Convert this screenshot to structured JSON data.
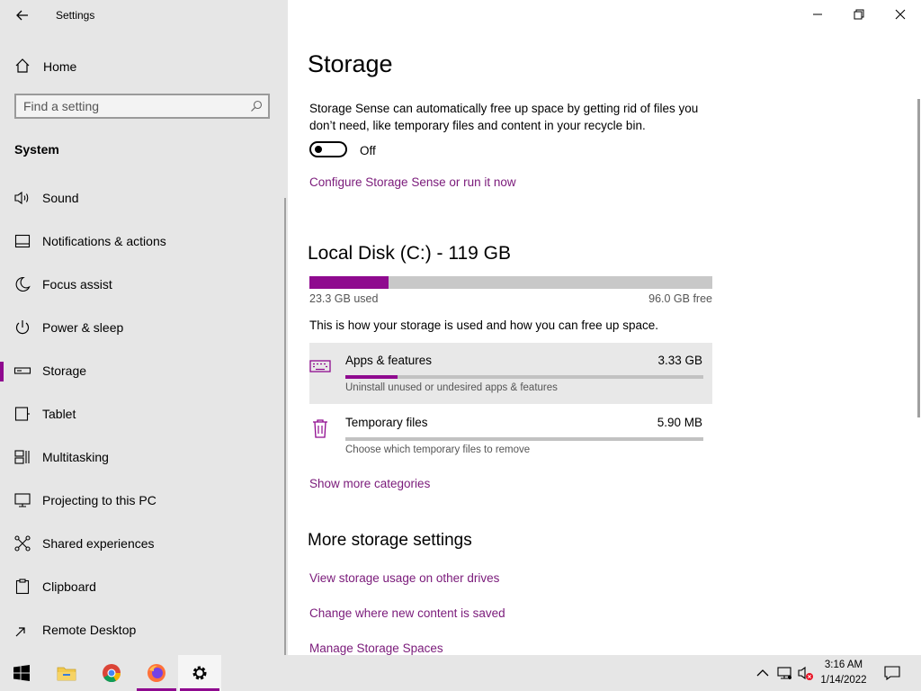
{
  "window": {
    "title": "Settings"
  },
  "sidebar": {
    "home_label": "Home",
    "search_placeholder": "Find a setting",
    "section": "System",
    "items": [
      {
        "label": "Sound",
        "icon": "speaker-icon",
        "active": false
      },
      {
        "label": "Notifications & actions",
        "icon": "notification-icon",
        "active": false
      },
      {
        "label": "Focus assist",
        "icon": "moon-icon",
        "active": false
      },
      {
        "label": "Power & sleep",
        "icon": "power-icon",
        "active": false
      },
      {
        "label": "Storage",
        "icon": "storage-icon",
        "active": true
      },
      {
        "label": "Tablet",
        "icon": "tablet-icon",
        "active": false
      },
      {
        "label": "Multitasking",
        "icon": "multitasking-icon",
        "active": false
      },
      {
        "label": "Projecting to this PC",
        "icon": "projecting-icon",
        "active": false
      },
      {
        "label": "Shared experiences",
        "icon": "shared-experiences-icon",
        "active": false
      },
      {
        "label": "Clipboard",
        "icon": "clipboard-icon",
        "active": false
      },
      {
        "label": "Remote Desktop",
        "icon": "remote-desktop-icon",
        "active": false
      }
    ]
  },
  "main": {
    "title": "Storage",
    "storage_sense_desc": "Storage Sense can automatically free up space by getting rid of files you don’t need, like temporary files and content in your recycle bin.",
    "toggle_state": "Off",
    "configure_link": "Configure Storage Sense or run it now",
    "disk": {
      "title": "Local Disk (C:) - 119 GB",
      "used": "23.3 GB used",
      "free": "96.0 GB free",
      "used_fraction": 0.196
    },
    "usage_desc": "This is how your storage is used and how you can free up space.",
    "categories": [
      {
        "name": "Apps & features",
        "size": "3.33 GB",
        "sub": "Uninstall unused or undesired apps & features",
        "fraction": 0.145,
        "icon": "keyboard-icon"
      },
      {
        "name": "Temporary files",
        "size": "5.90 MB",
        "sub": "Choose which temporary files to remove",
        "fraction": 0.0,
        "icon": "trash-icon"
      }
    ],
    "show_more": "Show more categories",
    "more_title": "More storage settings",
    "more_links": [
      "View storage usage on other drives",
      "Change where new content is saved",
      "Manage Storage Spaces"
    ]
  },
  "taskbar": {
    "time": "3:16 AM",
    "date": "1/14/2022"
  },
  "colors": {
    "accent": "#8f0a8f",
    "link": "#7a1a7a",
    "sidebar_bg": "#e6e6e6"
  }
}
